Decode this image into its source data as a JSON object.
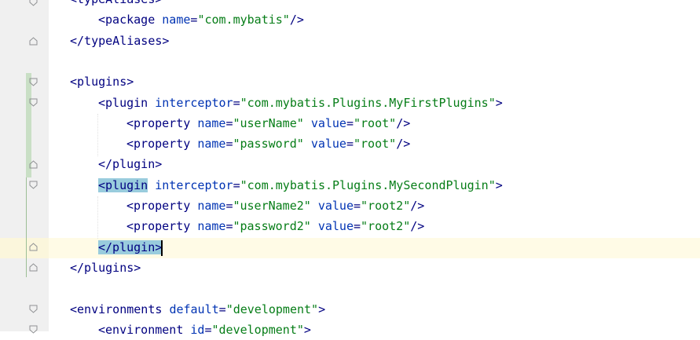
{
  "editor": {
    "gutter_icon": "fold-marker-icon",
    "lines": [
      {
        "indent": 0,
        "parts": [
          {
            "k": "tag",
            "t": "<typeAliases>"
          }
        ]
      },
      {
        "indent": 1,
        "parts": [
          {
            "k": "tag",
            "t": "<package"
          },
          {
            "k": "sp",
            "t": " "
          },
          {
            "k": "attr",
            "t": "name"
          },
          {
            "k": "pun",
            "t": "="
          },
          {
            "k": "val",
            "t": "\"com.mybatis\""
          },
          {
            "k": "tag",
            "t": "/>"
          }
        ]
      },
      {
        "indent": 0,
        "parts": [
          {
            "k": "tag",
            "t": "</typeAliases>"
          }
        ]
      },
      {
        "indent": 0,
        "parts": []
      },
      {
        "indent": 0,
        "parts": [
          {
            "k": "tag",
            "t": "<plugins>"
          }
        ]
      },
      {
        "indent": 1,
        "parts": [
          {
            "k": "tag",
            "t": "<plugin"
          },
          {
            "k": "sp",
            "t": " "
          },
          {
            "k": "attr",
            "t": "interceptor"
          },
          {
            "k": "pun",
            "t": "="
          },
          {
            "k": "val",
            "t": "\"com.mybatis.Plugins.MyFirstPlugins\""
          },
          {
            "k": "tag",
            "t": ">"
          }
        ]
      },
      {
        "indent": 2,
        "parts": [
          {
            "k": "tag",
            "t": "<property"
          },
          {
            "k": "sp",
            "t": " "
          },
          {
            "k": "attr",
            "t": "name"
          },
          {
            "k": "pun",
            "t": "="
          },
          {
            "k": "val",
            "t": "\"userName\""
          },
          {
            "k": "sp",
            "t": " "
          },
          {
            "k": "attr",
            "t": "value"
          },
          {
            "k": "pun",
            "t": "="
          },
          {
            "k": "val",
            "t": "\"root\""
          },
          {
            "k": "tag",
            "t": "/>"
          }
        ]
      },
      {
        "indent": 2,
        "parts": [
          {
            "k": "tag",
            "t": "<property"
          },
          {
            "k": "sp",
            "t": " "
          },
          {
            "k": "attr",
            "t": "name"
          },
          {
            "k": "pun",
            "t": "="
          },
          {
            "k": "val",
            "t": "\"password\""
          },
          {
            "k": "sp",
            "t": " "
          },
          {
            "k": "attr",
            "t": "value"
          },
          {
            "k": "pun",
            "t": "="
          },
          {
            "k": "val",
            "t": "\"root\""
          },
          {
            "k": "tag",
            "t": "/>"
          }
        ]
      },
      {
        "indent": 1,
        "parts": [
          {
            "k": "tag",
            "t": "</plugin>"
          }
        ]
      },
      {
        "indent": 1,
        "parts": [
          {
            "k": "match",
            "t": "<plugin"
          },
          {
            "k": "sp",
            "t": " "
          },
          {
            "k": "attr",
            "t": "interceptor"
          },
          {
            "k": "pun",
            "t": "="
          },
          {
            "k": "val",
            "t": "\"com.mybatis.Plugins.MySecondPlugin\""
          },
          {
            "k": "tag",
            "t": ">"
          }
        ]
      },
      {
        "indent": 2,
        "parts": [
          {
            "k": "tag",
            "t": "<property"
          },
          {
            "k": "sp",
            "t": " "
          },
          {
            "k": "attr",
            "t": "name"
          },
          {
            "k": "pun",
            "t": "="
          },
          {
            "k": "val",
            "t": "\"userName2\""
          },
          {
            "k": "sp",
            "t": " "
          },
          {
            "k": "attr",
            "t": "value"
          },
          {
            "k": "pun",
            "t": "="
          },
          {
            "k": "val",
            "t": "\"root2\""
          },
          {
            "k": "tag",
            "t": "/>"
          }
        ]
      },
      {
        "indent": 2,
        "parts": [
          {
            "k": "tag",
            "t": "<property"
          },
          {
            "k": "sp",
            "t": " "
          },
          {
            "k": "attr",
            "t": "name"
          },
          {
            "k": "pun",
            "t": "="
          },
          {
            "k": "val",
            "t": "\"password2\""
          },
          {
            "k": "sp",
            "t": " "
          },
          {
            "k": "attr",
            "t": "value"
          },
          {
            "k": "pun",
            "t": "="
          },
          {
            "k": "val",
            "t": "\"root2\""
          },
          {
            "k": "tag",
            "t": "/>"
          }
        ]
      },
      {
        "indent": 1,
        "parts": [
          {
            "k": "match",
            "t": "</plugin>"
          }
        ]
      },
      {
        "indent": 0,
        "parts": [
          {
            "k": "tag",
            "t": "</plugins>"
          }
        ]
      },
      {
        "indent": 0,
        "parts": []
      },
      {
        "indent": 0,
        "parts": [
          {
            "k": "tag",
            "t": "<environments"
          },
          {
            "k": "sp",
            "t": " "
          },
          {
            "k": "attr",
            "t": "default"
          },
          {
            "k": "pun",
            "t": "="
          },
          {
            "k": "val",
            "t": "\"development\""
          },
          {
            "k": "tag",
            "t": ">"
          }
        ]
      },
      {
        "indent": 1,
        "parts": [
          {
            "k": "tag",
            "t": "<environment"
          },
          {
            "k": "sp",
            "t": " "
          },
          {
            "k": "attr",
            "t": "id"
          },
          {
            "k": "pun",
            "t": "="
          },
          {
            "k": "val",
            "t": "\"development\""
          },
          {
            "k": "tag",
            "t": ">"
          }
        ]
      }
    ]
  },
  "colors": {
    "tag": "#000080",
    "attribute": "#0033b3",
    "value": "#067d17",
    "brace_match": "#99ccdd",
    "current_line": "#fffbe6",
    "vcs_added": "#c9dfc5"
  }
}
